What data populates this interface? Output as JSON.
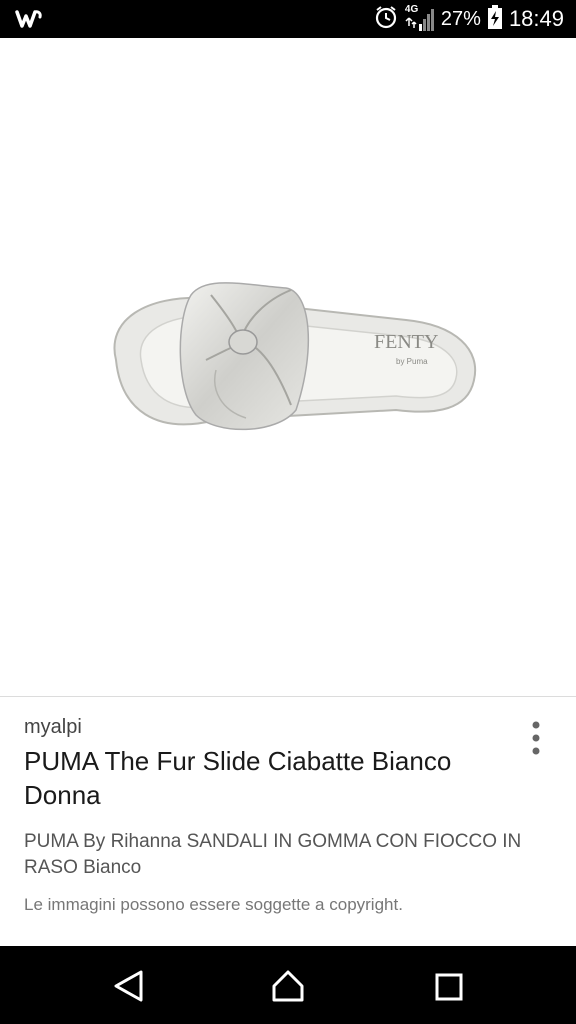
{
  "status_bar": {
    "app_icon": "wish-logo-icon",
    "icons": [
      "alarm-clock-icon",
      "signal-4g-icon",
      "battery-charging-icon"
    ],
    "network_label": "4G",
    "battery": "27%",
    "time": "18:49"
  },
  "product_image": {
    "logo_text": "FENTY",
    "brand_sub": "by Puma"
  },
  "result": {
    "source": "myalpi",
    "title": "PUMA The Fur Slide Ciabatte Bianco Donna",
    "description": "PUMA By Rihanna SANDALI IN GOMMA CON FIOCCO IN RASO Bianco",
    "copyright": "Le immagini possono essere soggette a copyright."
  },
  "nav_bar": {
    "back_icon": "back-triangle-icon",
    "home_icon": "home-icon",
    "recents_icon": "recents-square-icon"
  }
}
